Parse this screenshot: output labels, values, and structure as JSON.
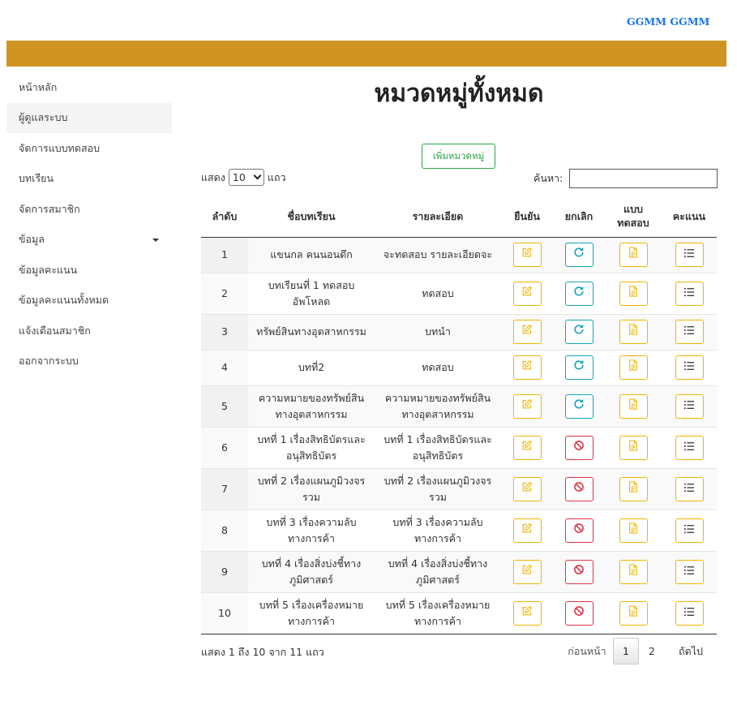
{
  "header": {
    "user": "GGMM GGMM",
    "bar_color": "#d09423"
  },
  "sidebar": {
    "items": [
      {
        "label": "หน้าหลัก"
      },
      {
        "label": "ผู้ดูแลระบบ"
      },
      {
        "label": "จัดการแบบทดสอบ"
      },
      {
        "label": "บทเรียน"
      },
      {
        "label": "จัดการสมาชิก"
      },
      {
        "label": "ข้อมูล"
      },
      {
        "label": "ข้อมูลคะแนน"
      },
      {
        "label": "ข้อมูลคะแนนทั้งหมด"
      },
      {
        "label": "แจ้งเตือนสมาชิก"
      },
      {
        "label": "ออกจากระบบ"
      }
    ]
  },
  "main": {
    "title": "หมวดหมู่ทั้งหมด",
    "add_button": "เพิ่มหมวดหมู่",
    "length": {
      "prefix": "แสดง",
      "value": "10",
      "suffix": "แถว"
    },
    "search": {
      "label": "ค้นหา:",
      "value": "",
      "placeholder": ""
    },
    "columns": [
      "ลำดับ",
      "ชื่อบทเรียน",
      "รายละเอียด",
      "ยืนยัน",
      "ยกเลิก",
      "แบบ ทดสอบ",
      "คะแนน"
    ],
    "rows": [
      {
        "no": "1",
        "name": "แขนกล คนนอนดึก",
        "detail": "จะทดสอบ รายละเอียดจะ",
        "cancel": "redo"
      },
      {
        "no": "2",
        "name": "บทเรียนที่ 1 ทดสอบอัพโหลด",
        "detail": "ทดสอบ",
        "cancel": "redo"
      },
      {
        "no": "3",
        "name": "ทรัพย์สินทางอุตสาหกรรม",
        "detail": "บทนำ",
        "cancel": "redo"
      },
      {
        "no": "4",
        "name": "บทที่2",
        "detail": "ทดสอบ",
        "cancel": "redo"
      },
      {
        "no": "5",
        "name": "ความหมายของทรัพย์สินทางอุตสาหกรรม",
        "detail": "ความหมายของทรัพย์สินทางอุตสาหกรรม",
        "cancel": "redo"
      },
      {
        "no": "6",
        "name": "บทที่ 1 เรื่องสิทธิบัตรและอนุสิทธิบัตร",
        "detail": "บทที่ 1 เรื่องสิทธิบัตรและอนุสิทธิบัตร",
        "cancel": "ban"
      },
      {
        "no": "7",
        "name": "บทที่ 2 เรื่องแผนภูมิวงจรรวม",
        "detail": "บทที่ 2 เรื่องแผนภูมิวงจรรวม",
        "cancel": "ban"
      },
      {
        "no": "8",
        "name": "บทที่ 3 เรื่องความลับทางการค้า",
        "detail": "บทที่ 3 เรื่องความลับทางการค้า",
        "cancel": "ban"
      },
      {
        "no": "9",
        "name": "บทที่ 4 เรื่องสิ่งบ่งชี้ทางภูมิศาสตร์",
        "detail": "บทที่ 4 เรื่องสิ่งบ่งชี้ทางภูมิศาสตร์",
        "cancel": "ban"
      },
      {
        "no": "10",
        "name": "บทที่ 5 เรื่องเครื่องหมายทางการค้า",
        "detail": "บทที่ 5 เรื่องเครื่องหมายทางการค้า",
        "cancel": "ban"
      }
    ],
    "info": "แสดง 1 ถึง 10 จาก 11 แถว",
    "pagination": {
      "prev": "ก่อนหน้า",
      "pages": [
        "1",
        "2"
      ],
      "next": "ถัดไป"
    },
    "colors": {
      "warning": "#f0b400",
      "info": "#17a2b8",
      "danger": "#dc3545",
      "success": "#28a745"
    },
    "icons": {
      "confirm": "edit-icon",
      "cancel_active": "redo-icon",
      "cancel_blocked": "ban-icon",
      "quiz": "document-icon",
      "score": "list-icon"
    }
  }
}
